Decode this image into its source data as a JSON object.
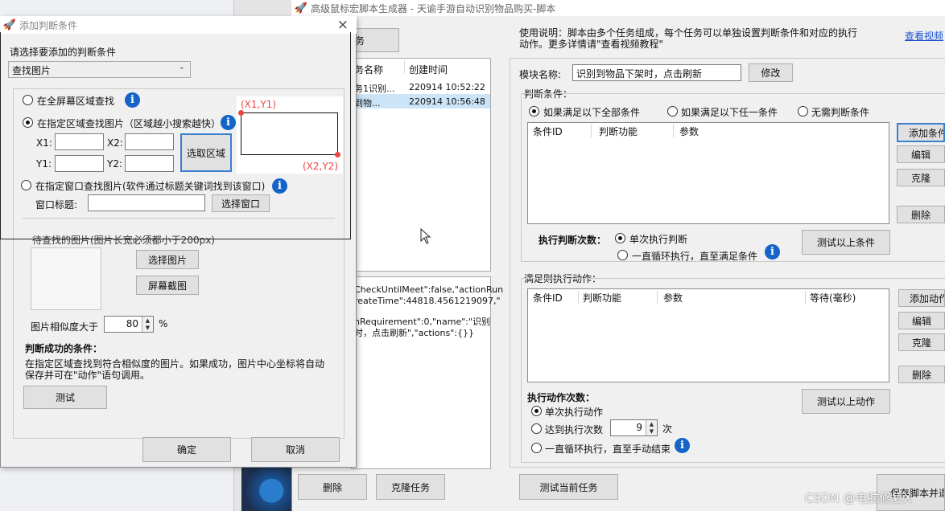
{
  "main_window": {
    "title": "高级鼠标宏脚本生成器 - 天谕手游自动识别物品购买-脚本",
    "add_task_button": "务",
    "task_list": {
      "headers": [
        "务名称",
        "创建时间"
      ],
      "rows": [
        {
          "name": "务1识别...",
          "time": "220914 10:52:22"
        },
        {
          "name": "到物...",
          "time": "220914 10:56:48"
        }
      ]
    },
    "json_preview": [
      "CheckUntilMeet\":false,\"actionRun",
      "reateTime\":44818.4561219097,\"",
      "",
      "nRequirement\":0,\"name\":\"识别",
      "时，点击刷新\",\"actions\":{}}"
    ],
    "usage_text_1": "使用说明：脚本由多个任务组成，每个任务可以单独设置判断条件和对应的执行",
    "usage_text_2": "动作。更多详情请\"查看视频教程\"",
    "video_link": "查看视频",
    "module_name_label": "模块名称:",
    "module_name_value": "识别到物品下架时，点击刷新",
    "modify_button": "修改",
    "condition_section_label": "判断条件：",
    "cond_radio_all": "如果满足以下全部条件",
    "cond_radio_any": "如果满足以下任一条件",
    "cond_radio_none": "无需判断条件",
    "cond_table_headers": [
      "条件ID",
      "判断功能",
      "参数"
    ],
    "add_condition_button": "添加条件",
    "edit_button": "编辑",
    "clone_button": "克隆",
    "delete_button": "删除",
    "exec_judge_label": "执行判断次数：",
    "exec_judge_once": "单次执行判断",
    "exec_judge_loop": "一直循环执行，直至满足条件",
    "test_conditions_button": "测试以上条件",
    "action_section_label": "满足则执行动作：",
    "action_table_headers": [
      "条件ID",
      "判断功能",
      "参数",
      "等待(毫秒)"
    ],
    "add_action_button": "添加动作",
    "exec_action_label": "执行动作次数：",
    "exec_action_once": "单次执行动作",
    "exec_action_count": "达到执行次数",
    "exec_action_count_value": "9",
    "exec_action_count_unit": "次",
    "exec_action_loop": "一直循环执行，直至手动结束",
    "test_actions_button": "测试以上动作",
    "delete_task_button": "删除",
    "clone_task_button": "克隆任务",
    "test_current_task_button": "测试当前任务",
    "save_script_button": "保存脚本并退"
  },
  "dialog": {
    "title": "添加判断条件",
    "close_glyph": "×",
    "prompt": "请选择要添加的判断条件",
    "condition_type": "查找图片",
    "radio_fullscreen": "在全屏幕区域查找",
    "radio_region": "在指定区域查找图片（区域越小搜索越快）",
    "x1_label": "X1:",
    "x2_label": "X2:",
    "y1_label": "Y1:",
    "y2_label": "Y2:",
    "select_region_button": "选取区域",
    "region_top_left": "(X1,Y1)",
    "region_bottom_right": "(X2,Y2)",
    "radio_window": "在指定窗口查找图片(软件通过标题关键词找到该窗口)",
    "window_title_label": "窗口标题:",
    "select_window_button": "选择窗口",
    "image_section_label": "待查找的图片(图片长宽必须都小于200px)",
    "select_image_button": "选择图片",
    "screenshot_button": "屏幕截图",
    "similarity_label": "图片相似度大于",
    "similarity_value": "80",
    "similarity_unit": "%",
    "success_title": "判断成功的条件：",
    "success_desc_1": "在指定区域查找到符合相似度的图片。如果成功，图片中心坐标将自动",
    "success_desc_2": "保存并可在\"动作\"语句调用。",
    "test_button": "测试",
    "ok_button": "确定",
    "cancel_button": "取消"
  },
  "watermark": "CSDN @电脑修复X"
}
